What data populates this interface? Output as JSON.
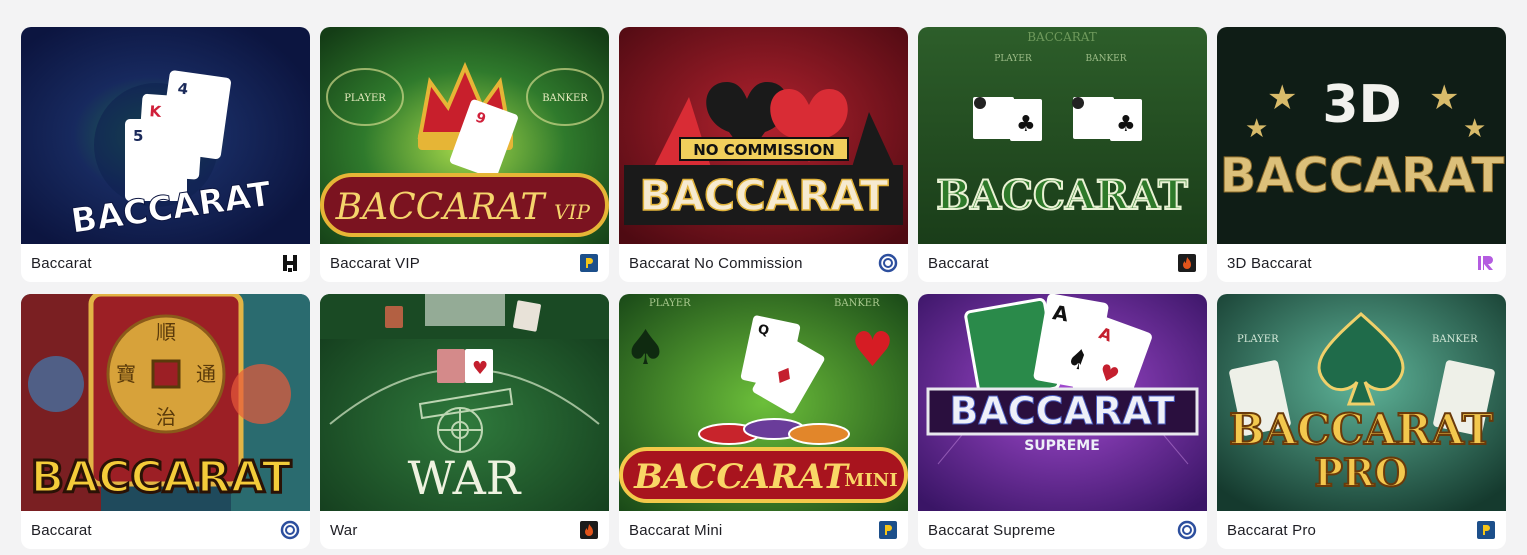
{
  "games": [
    {
      "name": "Baccarat",
      "art_text": "BACCARAT",
      "provider_icon": "h-logo-icon"
    },
    {
      "name": "Baccarat VIP",
      "art_text": "BACCARAT",
      "art_sub": "VIP",
      "art_labels": [
        "PLAYER",
        "BANKER"
      ],
      "provider_icon": "p-logo-icon"
    },
    {
      "name": "Baccarat No Commission",
      "art_text": "BACCARAT",
      "art_banner": "NO COMMISSION",
      "provider_icon": "ring-logo-icon"
    },
    {
      "name": "Baccarat",
      "art_text": "BACCARAT",
      "art_top": "BACCARAT",
      "art_labels": [
        "PLAYER",
        "BANKER"
      ],
      "provider_icon": "flame-logo-icon"
    },
    {
      "name": "3D Baccarat",
      "art_text": "BACCARAT",
      "art_top": "3D",
      "provider_icon": "ir-logo-icon"
    },
    {
      "name": "Baccarat",
      "art_text": "BACCARAT",
      "provider_icon": "ring-logo-icon"
    },
    {
      "name": "War",
      "art_text": "WAR",
      "provider_icon": "flame-logo-icon"
    },
    {
      "name": "Baccarat Mini",
      "art_text": "BACCARAT",
      "art_sub": "MINI",
      "art_labels": [
        "PLAYER",
        "BANKER"
      ],
      "provider_icon": "p-logo-icon"
    },
    {
      "name": "Baccarat Supreme",
      "art_text": "BACCARAT",
      "art_sub": "SUPREME",
      "provider_icon": "ring-logo-icon"
    },
    {
      "name": "Baccarat Pro",
      "art_text": "BACCARAT",
      "art_sub": "PRO",
      "art_labels": [
        "PLAYER",
        "BANKER"
      ],
      "provider_icon": "p-logo-icon"
    }
  ],
  "colors": {
    "page_bg": "#f3f3f4",
    "card_bg": "#ffffff",
    "text": "#1e1e24",
    "provider_p": "#1c4f8a",
    "provider_ring": "#2d4f9e",
    "provider_flame": "#e2541b",
    "provider_ir": "#b45ce0"
  }
}
